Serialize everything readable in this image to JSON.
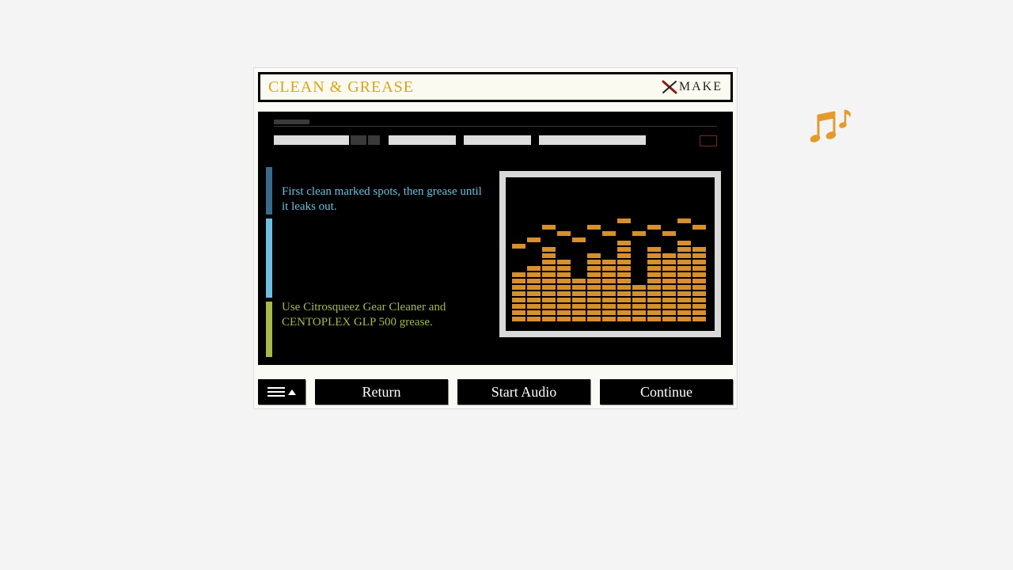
{
  "header": {
    "title": "CLEAN & GREASE",
    "logo_text": "MAKE",
    "logo_sub": ""
  },
  "instructions": {
    "step1": "First clean marked spots, then grease until it leaks out.",
    "step2": "Use Citrosqueez Gear Cleaner and CENTOPLEX GLP 500 grease."
  },
  "equalizer": {
    "bars": [
      8,
      9,
      12,
      10,
      7,
      11,
      10,
      13,
      6,
      12,
      11,
      13,
      12
    ],
    "peaks": [
      11,
      12,
      14,
      13,
      12,
      14,
      13,
      15,
      13,
      14,
      13,
      15,
      14
    ]
  },
  "buttons": {
    "return": "Return",
    "start_audio": "Start Audio",
    "continue": "Continue"
  },
  "colors": {
    "accent_orange": "#d6902c",
    "title_gold": "#d6a419",
    "blue": "#6fbfe0",
    "green": "#a8b84a"
  }
}
